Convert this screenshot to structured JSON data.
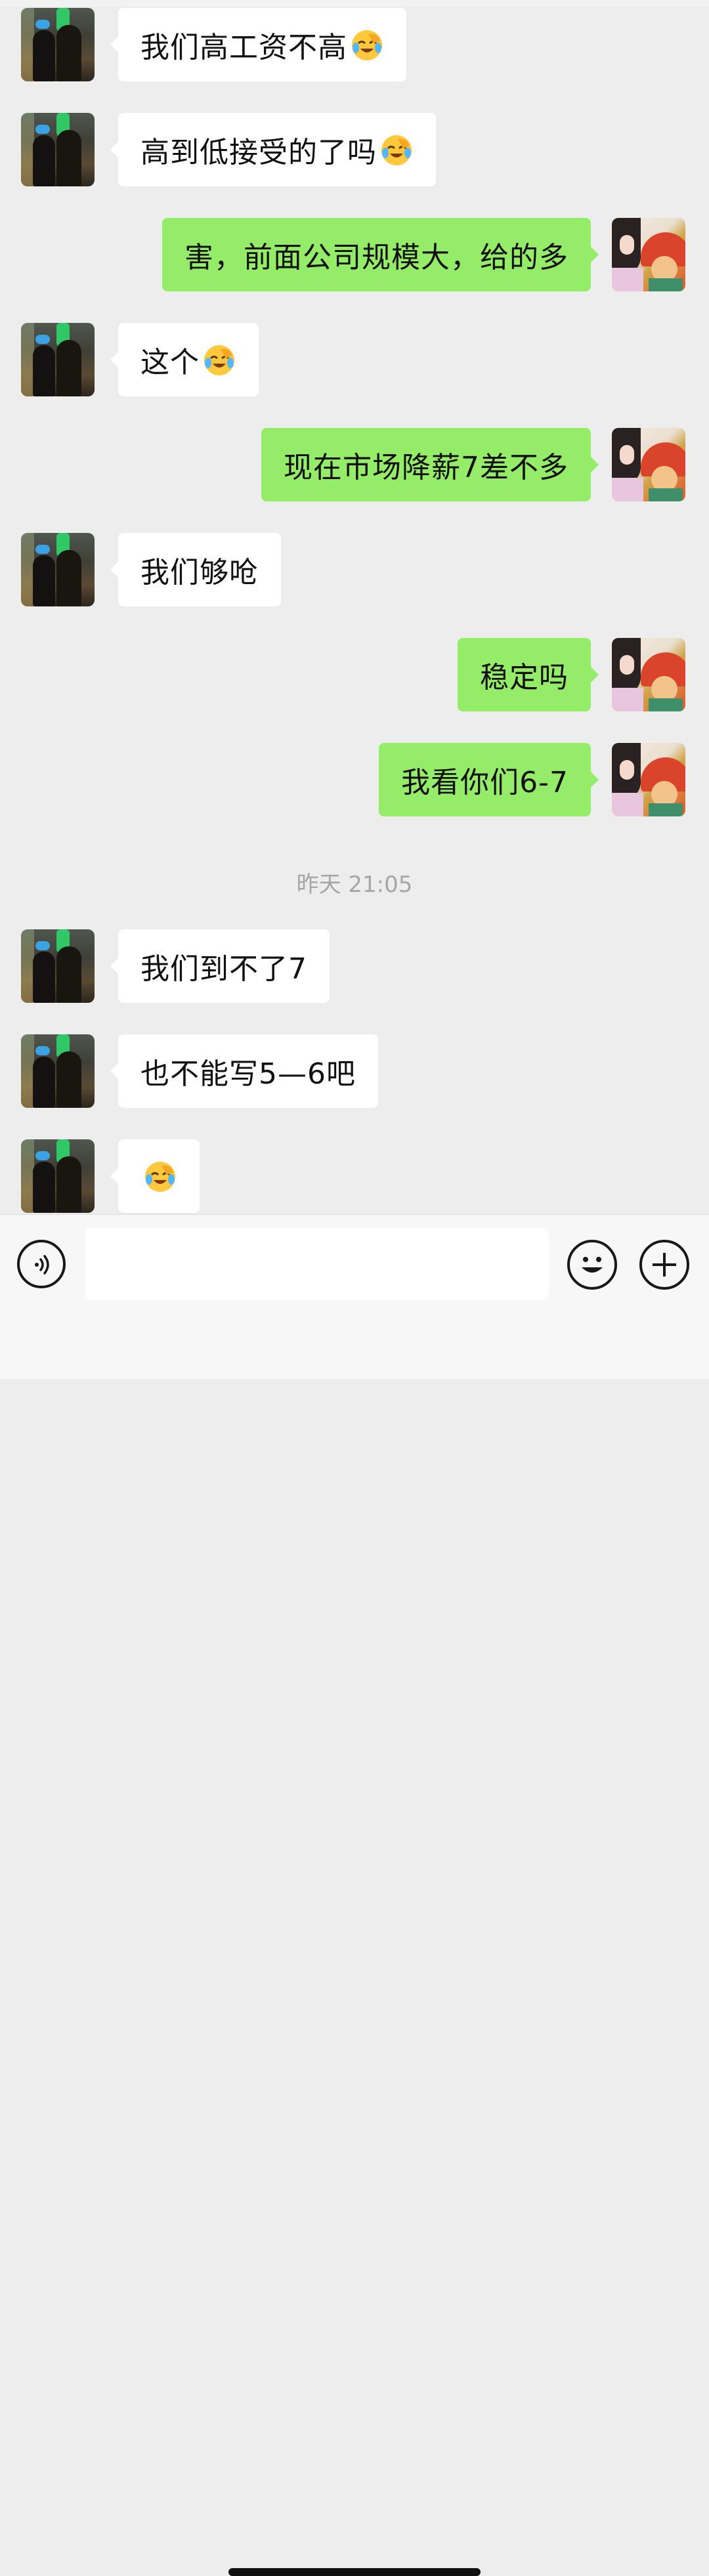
{
  "chat": {
    "messages": [
      {
        "side": "left",
        "text": "我们高工资不高",
        "emoji": "facepalm-laugh-emoji"
      },
      {
        "side": "left",
        "text": "高到低接受的了吗",
        "emoji": "facepalm-laugh-emoji"
      },
      {
        "side": "right",
        "text": "害，前面公司规模大，给的多"
      },
      {
        "side": "left",
        "text": "这个",
        "emoji": "facepalm-laugh-emoji"
      },
      {
        "side": "right",
        "text": "现在市场降薪7差不多"
      },
      {
        "side": "left",
        "text": "我们够呛"
      },
      {
        "side": "right",
        "text": "稳定吗"
      },
      {
        "side": "right",
        "text": "我看你们6-7"
      },
      {
        "side": "left",
        "text": "我们到不了7"
      },
      {
        "side": "left",
        "text": "也不能写5—6吧"
      },
      {
        "side": "left",
        "text": "",
        "emoji": "facepalm-laugh-emoji"
      }
    ],
    "timestamp": "昨天 21:05"
  },
  "input_bar": {
    "voice_icon": "voice-icon",
    "input_value": "",
    "emoji_icon": "smiley-icon",
    "plus_icon": "plus-icon"
  },
  "colors": {
    "background": "#ededed",
    "incoming_bubble": "#ffffff",
    "outgoing_bubble": "#95ec69",
    "timestamp_text": "#a6a6a6"
  }
}
